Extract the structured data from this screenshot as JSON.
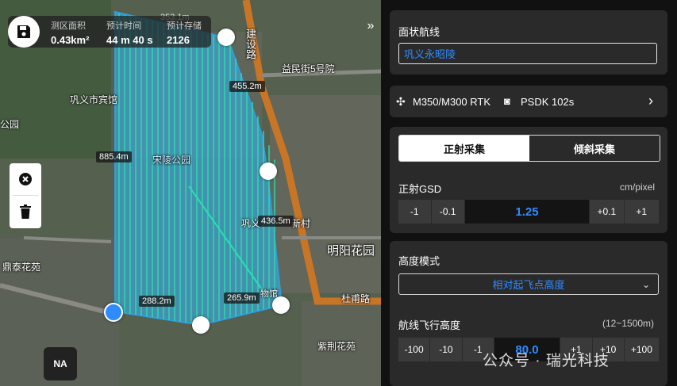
{
  "map": {
    "stats": [
      {
        "label": "测区面积",
        "value": "0.43km²"
      },
      {
        "label": "预计时间",
        "value": "44 m 40 s"
      },
      {
        "label": "预计存储",
        "value": "2126"
      }
    ],
    "top_tick": "353.1m",
    "distances": [
      "455.2m",
      "885.4m",
      "436.5m",
      "288.2m",
      "265.9m"
    ],
    "places": [
      "建设路",
      "益民街5号院",
      "巩义市宾馆",
      "公园",
      "宋陵公园",
      "巩义",
      "新村",
      "明阳花园",
      "鼎泰花苑",
      "杜甫路",
      "紫荆花苑",
      "物馆"
    ],
    "na_label": "NA",
    "colors": {
      "polygon": "#3aaee8",
      "lines": "#27e0b0",
      "road": "#d07a2a"
    }
  },
  "panel": {
    "route_title": "面状航线",
    "route_name": "巩义永昭陵",
    "aircraft": "M350/M300 RTK",
    "camera": "PSDK 102s",
    "tabs": {
      "active": "正射采集",
      "inactive": "倾斜采集"
    },
    "gsd": {
      "label": "正射GSD",
      "unit": "cm/pixel",
      "buttons": [
        "-1",
        "-0.1",
        "+0.1",
        "+1"
      ],
      "value": "1.25"
    },
    "height_mode": {
      "label": "高度模式",
      "selected": "相对起飞点高度"
    },
    "altitude": {
      "label": "航线飞行高度",
      "range": "(12~1500m)",
      "buttons": [
        "-100",
        "-10",
        "-1",
        "+1",
        "+10",
        "+100"
      ],
      "value": "80.0"
    }
  },
  "watermark": "公众号 · 瑞光科技"
}
